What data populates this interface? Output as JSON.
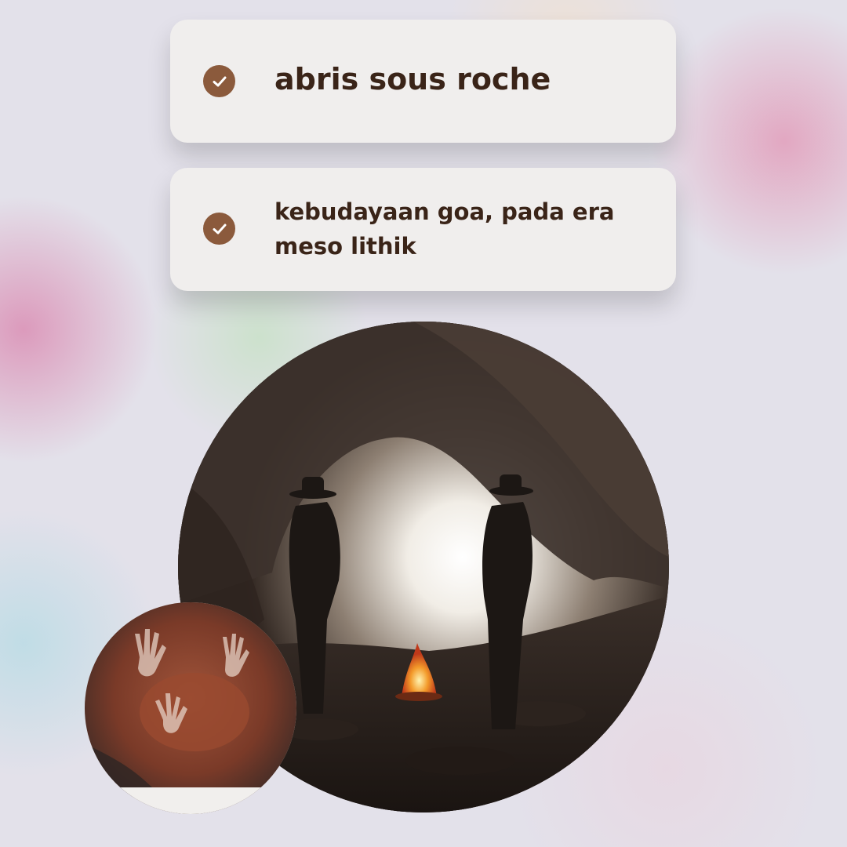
{
  "cards": [
    {
      "text": "abris sous roche",
      "icon": "check-circle-icon"
    },
    {
      "text": "kebudayaan goa, pada era meso lithik",
      "icon": "check-circle-icon"
    }
  ],
  "images": {
    "main": "cave-silhouettes-campfire-photo",
    "small": "cave-hand-paintings-photo"
  },
  "colors": {
    "accent": "#8b5a3c",
    "text": "#3a2418",
    "card": "#f0eeed"
  }
}
